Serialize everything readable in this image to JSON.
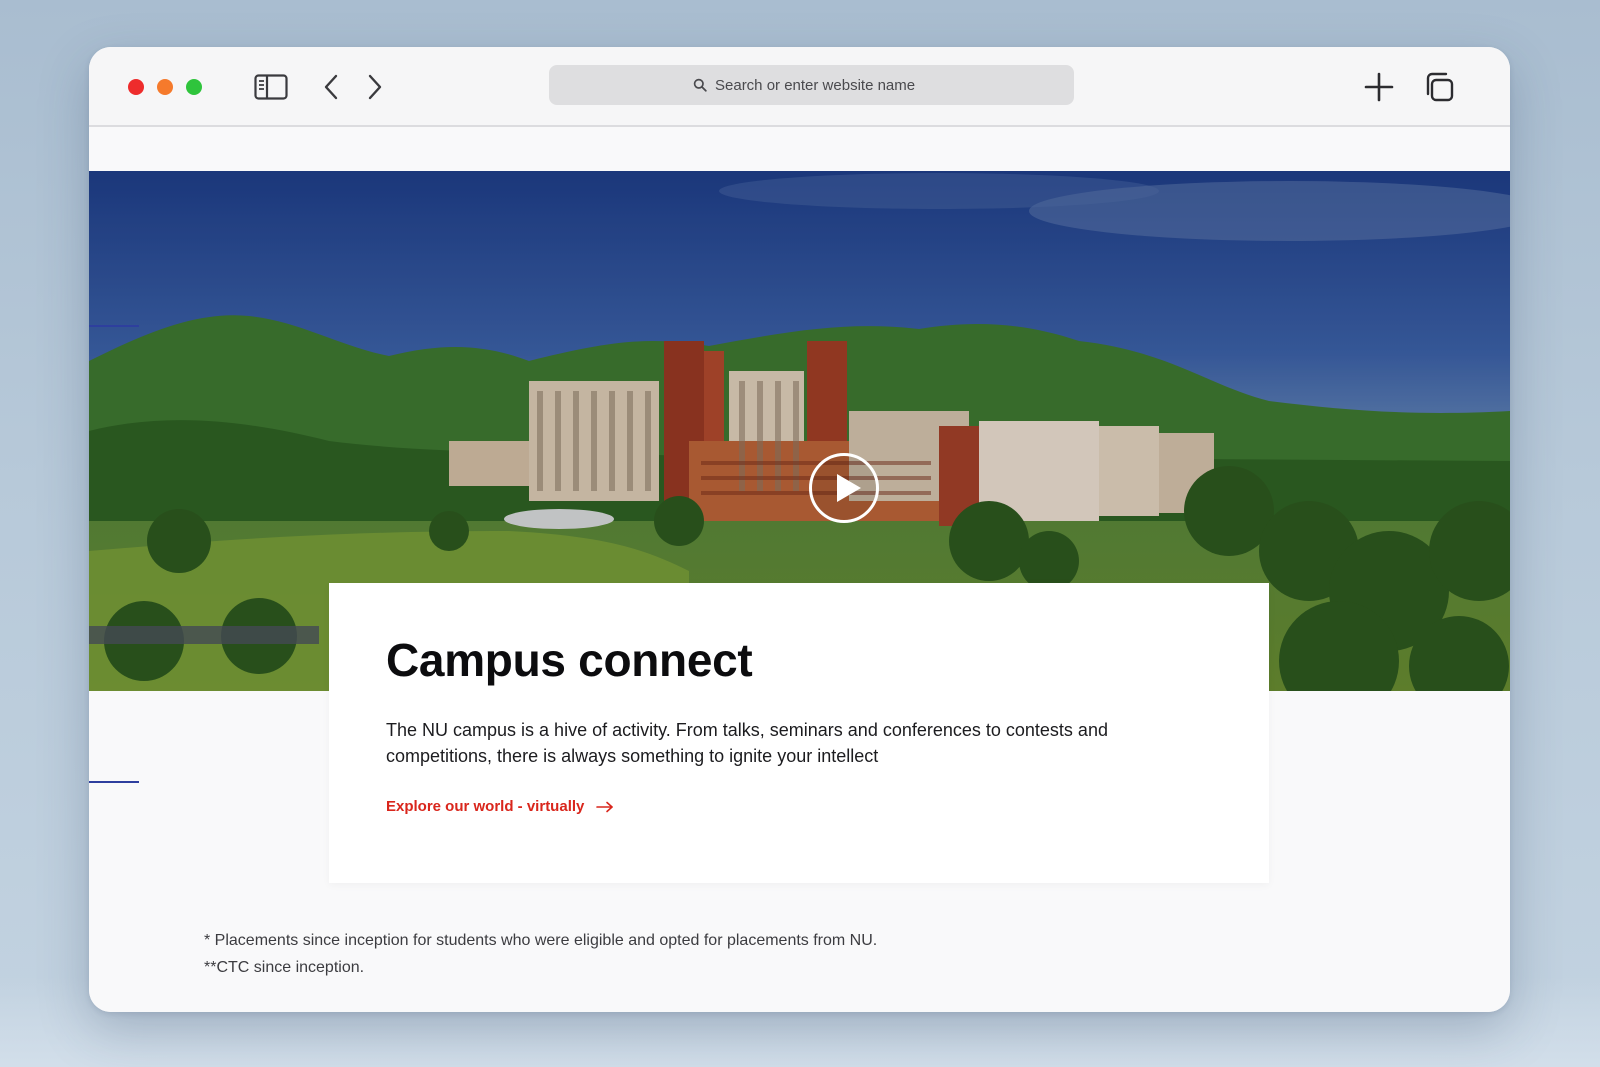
{
  "browser": {
    "search_placeholder": "Search or enter website name",
    "icons": {
      "sidebar": "sidebar-icon",
      "back": "chevron-left-icon",
      "forward": "chevron-right-icon",
      "search": "search-icon",
      "new_tab": "plus-icon",
      "tabs_overview": "tabs-icon"
    },
    "traffic_lights": [
      "#ee2c2c",
      "#f57a2c",
      "#2fc43c"
    ]
  },
  "hero": {
    "image": "campus-aerial-photo",
    "play_icon": "play-icon"
  },
  "card": {
    "title": "Campus connect",
    "description": "The NU campus is a hive of activity. From talks, seminars and conferences to contests and competitions, there is always something to ignite your intellect",
    "link_label": "Explore our world - virtually",
    "link_icon": "arrow-right-icon",
    "link_color": "#d9261c"
  },
  "footnotes": {
    "line1": "* Placements since inception for students who were eligible and opted for placements from NU.",
    "line2": "**CTC since inception."
  },
  "colors": {
    "accent_line": "#2e3f9e"
  }
}
